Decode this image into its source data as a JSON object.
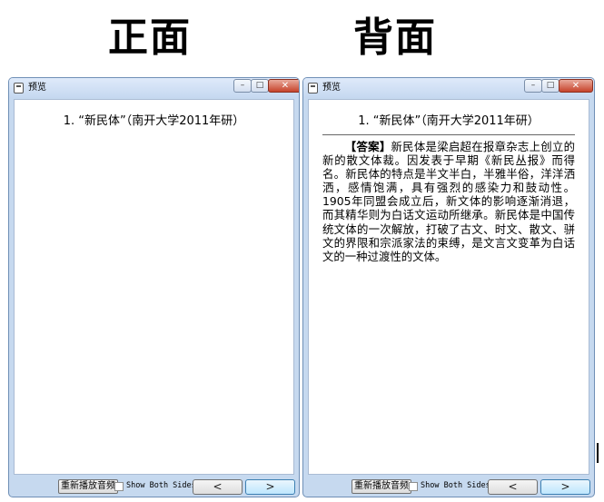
{
  "captions": {
    "front": "正面",
    "back": "背面"
  },
  "window_title": "预览",
  "window_controls": {
    "minimize": "–",
    "maximize": "□",
    "close": "✕"
  },
  "question": "1. “新民体”（南开大学2011年研）",
  "answer": {
    "tag": "【答案】",
    "text": "新民体是梁启超在报章杂志上创立的新的散文体裁。因发表于早期《新民丛报》而得名。新民体的特点是半文半白，半雅半俗，洋洋洒洒，感情饱满，具有强烈的感染力和鼓动性。1905年同盟会成立后，新文体的影响逐渐消退，而其精华则为白话文运动所继承。新民体是中国传统文体的一次解放，打破了古文、时文、散文、骈文的界限和宗派家法的束缚，是文言文变革为白话文的一种过渡性的文体。"
  },
  "bottom_bar": {
    "replay_label": "重新播放音频",
    "show_both_sides_label": "Show Both Sides",
    "show_both_sides_checked": false,
    "prev_label": "<",
    "next_label": ">"
  }
}
